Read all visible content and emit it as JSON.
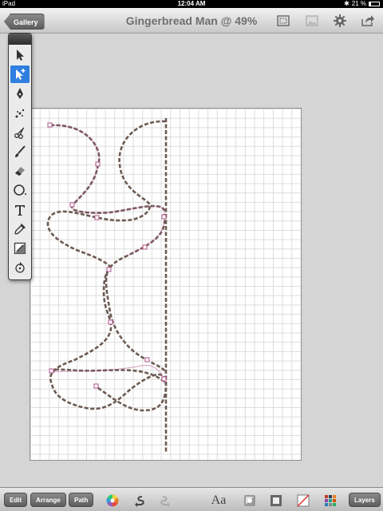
{
  "status": {
    "device": "iPad",
    "time": "12:04 AM",
    "battery": "21 %"
  },
  "nav": {
    "back_label": "Gallery",
    "title": "Gingerbread Man @ 49%"
  },
  "bottom": {
    "edit": "Edit",
    "arrange": "Arrange",
    "path": "Path",
    "text_style": "Aa",
    "layers": "Layers"
  },
  "tools": [
    "select-arrow",
    "node-select",
    "pen",
    "scatter",
    "scissors",
    "brush",
    "eraser",
    "ellipse",
    "text",
    "eyedropper",
    "gradient",
    "rotate"
  ],
  "colors": {
    "stroke": "#6b5a52",
    "node": "#b0508a",
    "accent": "#2f7fe0"
  }
}
